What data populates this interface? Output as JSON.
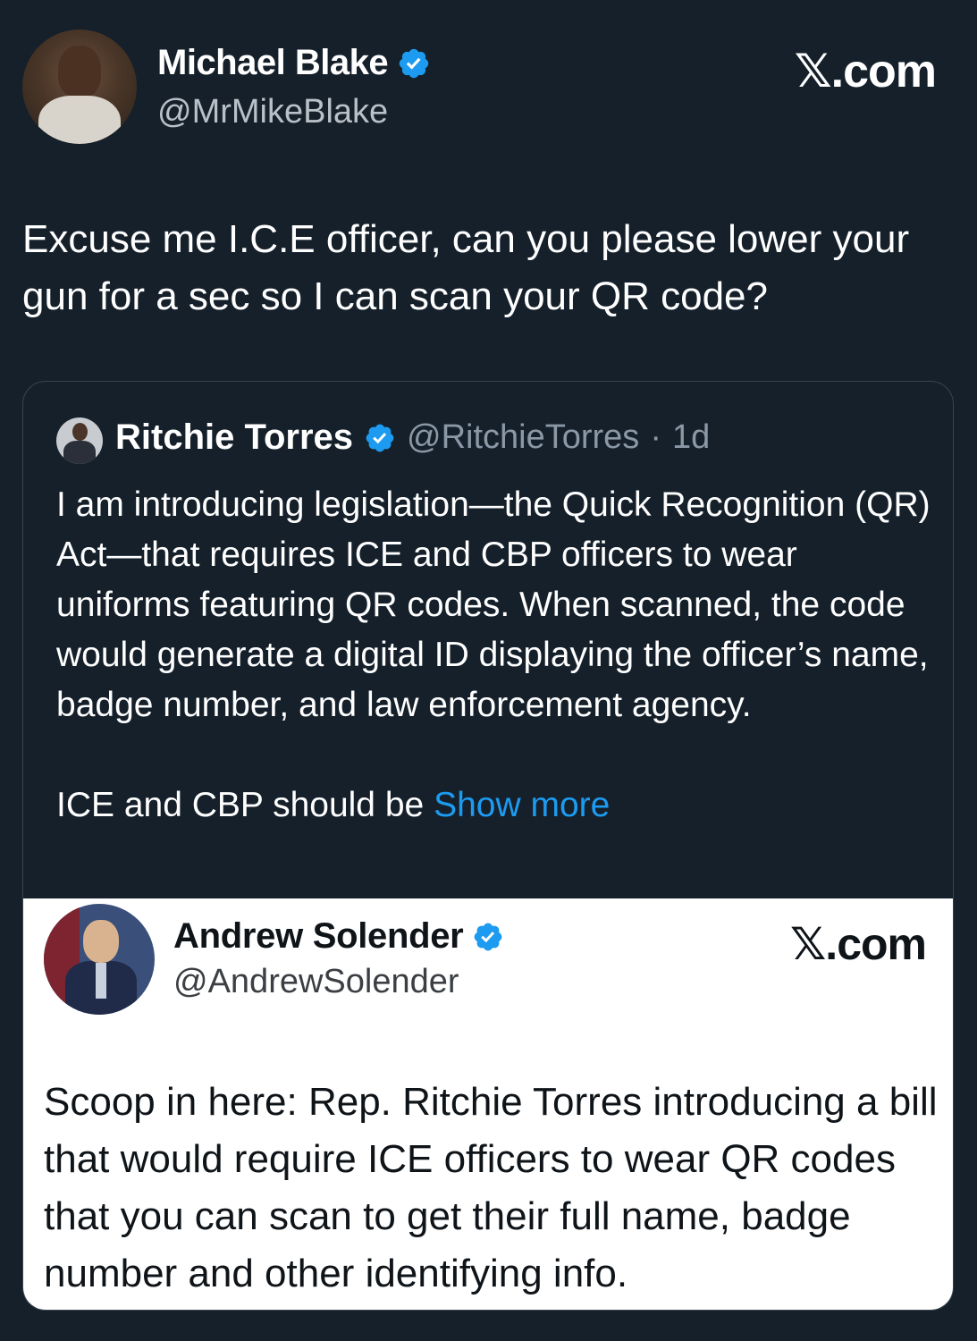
{
  "post": {
    "author_name": "Michael Blake",
    "author_handle": "@MrMikeBlake",
    "brand": "𝕏.com",
    "text": "Excuse me I.C.E officer, can you please lower your gun for a sec so I can scan your QR code?"
  },
  "quote": {
    "author_name": "Ritchie Torres",
    "author_handle": "@RitchieTorres",
    "separator": "·",
    "time": "1d",
    "paragraph1": "I am introducing legislation—the Quick Recognition (QR) Act—that requires ICE and CBP officers to wear uniforms featuring QR codes. When scanned, the code would generate a digital ID displaying the officer’s name, badge number, and law enforcement agency.",
    "paragraph2": "ICE and CBP should be",
    "show_more": "Show more"
  },
  "media": {
    "author_name": "Andrew Solender",
    "author_handle": "@AndrewSolender",
    "brand": "𝕏.com",
    "text": "Scoop in here: Rep. Ritchie Torres introducing a bill that would require ICE officers to wear QR codes that you can scan to get their full name, badge number and other identifying info."
  },
  "colors": {
    "background": "#15202b",
    "verified": "#1d9bf0",
    "link": "#1d9bf0",
    "border": "#38444d"
  },
  "icons": [
    "verified-badge-icon"
  ]
}
